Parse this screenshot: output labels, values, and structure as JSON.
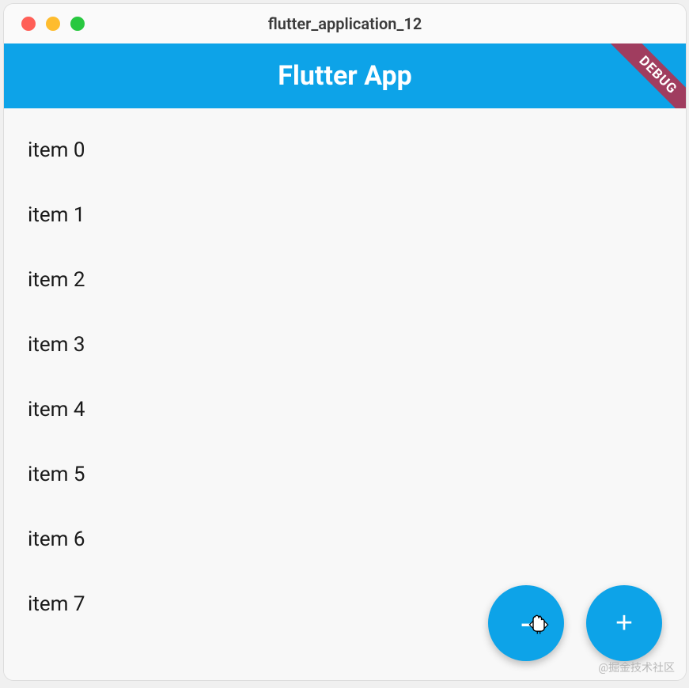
{
  "window": {
    "title": "flutter_application_12"
  },
  "appbar": {
    "title": "Flutter App",
    "debug_banner": "DEBUG"
  },
  "list": {
    "items": [
      "item 0",
      "item 1",
      "item 2",
      "item 3",
      "item 4",
      "item 5",
      "item 6",
      "item 7"
    ]
  },
  "fab": {
    "minus_label": "-",
    "plus_label": "+"
  },
  "watermark": "@掘金技术社区"
}
